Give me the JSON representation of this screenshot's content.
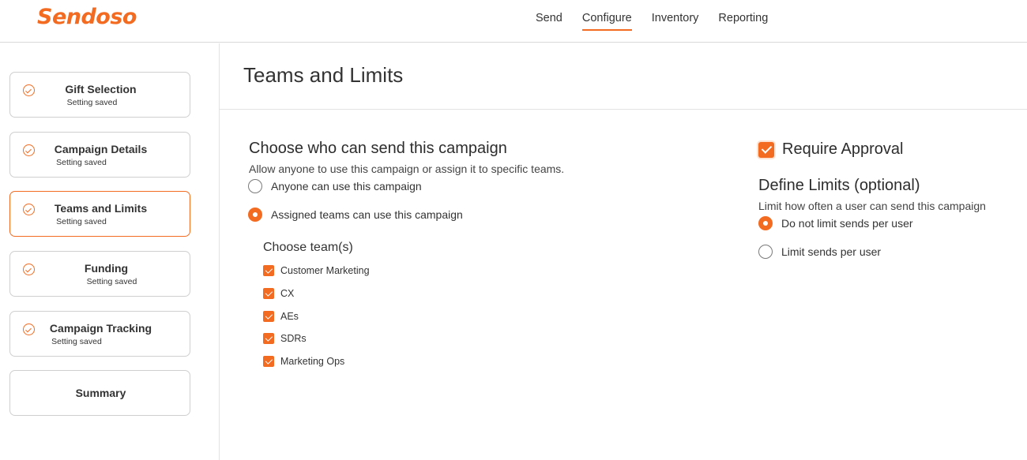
{
  "header": {
    "logo": "Sendoso",
    "nav": [
      "Send",
      "Configure",
      "Inventory",
      "Reporting"
    ],
    "active_nav": "Configure"
  },
  "sidebar": {
    "steps": [
      {
        "title": "Gift Selection",
        "status": "Setting saved"
      },
      {
        "title": "Campaign Details",
        "status": "Setting saved"
      },
      {
        "title": "Teams and Limits",
        "status": "Setting saved"
      },
      {
        "title": "Funding",
        "status": "Setting saved"
      },
      {
        "title": "Campaign Tracking",
        "status": "Setting saved"
      },
      {
        "title": "Summary",
        "status": ""
      }
    ],
    "active_step": "Teams and Limits"
  },
  "main": {
    "title": "Teams and Limits",
    "who": {
      "heading": "Choose who can send this campaign",
      "description": "Allow anyone to use this campaign or assign it to specific teams.",
      "options": [
        {
          "label": "Anyone can use this campaign",
          "selected": false
        },
        {
          "label": "Assigned teams can use this campaign",
          "selected": true
        }
      ],
      "teams_heading": "Choose team(s)",
      "teams": [
        {
          "label": "Customer Marketing",
          "checked": true
        },
        {
          "label": "CX",
          "checked": true
        },
        {
          "label": "AEs",
          "checked": true
        },
        {
          "label": "SDRs",
          "checked": true
        },
        {
          "label": "Marketing Ops",
          "checked": true
        }
      ]
    },
    "approval": {
      "label": "Require Approval",
      "checked": true
    },
    "limits": {
      "heading": "Define Limits (optional)",
      "description": "Limit how often a user can send this campaign",
      "options": [
        {
          "label": "Do not limit sends per user",
          "selected": true
        },
        {
          "label": "Limit sends per user",
          "selected": false
        }
      ]
    }
  },
  "colors": {
    "accent": "#f36b21"
  }
}
